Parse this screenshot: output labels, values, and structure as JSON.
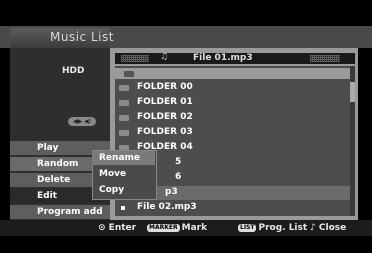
{
  "title": "Music List",
  "left": {
    "storage_label": "HDD",
    "disc_badge": "◀▶ ◀)"
  },
  "menu": [
    "Play",
    "Random",
    "Delete",
    "Edit",
    "Program add"
  ],
  "header": {
    "file_name": "File 01.mp3"
  },
  "rows": [
    {
      "label": "FOLDER 00",
      "type": "folder"
    },
    {
      "label": "FOLDER 01",
      "type": "folder"
    },
    {
      "label": "FOLDER 02",
      "type": "folder"
    },
    {
      "label": "FOLDER 03",
      "type": "folder"
    },
    {
      "label": "FOLDER 04",
      "type": "folder"
    },
    {
      "label": "5",
      "type": "folder"
    },
    {
      "label": "6",
      "type": "folder"
    },
    {
      "label": "p3",
      "type": "file"
    },
    {
      "label": "File 02.mp3",
      "type": "file"
    }
  ],
  "popup": [
    "Rename",
    "Move",
    "Copy"
  ],
  "bottom": {
    "enter": "⊙ Enter",
    "marker_badge": "MARKER",
    "marker_label": "Mark",
    "list_badge": "LIST",
    "list_label": "Prog. List",
    "close": "Close"
  }
}
